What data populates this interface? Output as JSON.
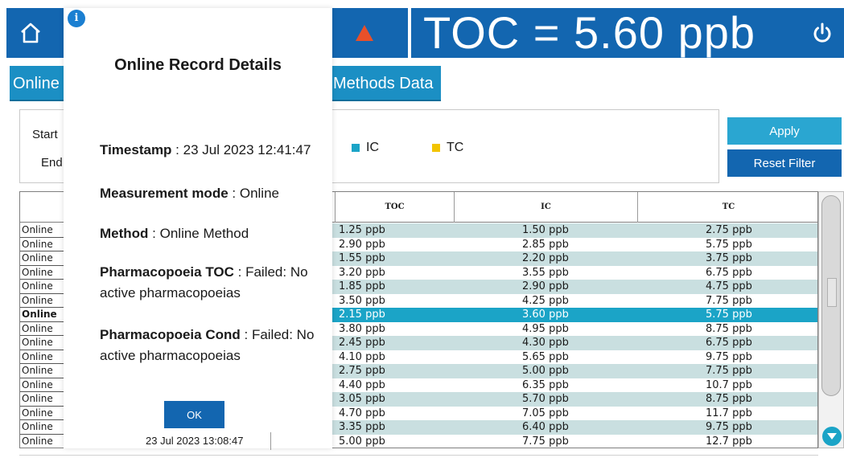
{
  "colors": {
    "topbar": "#1366b0",
    "tab": "#1b8fc4",
    "apply_button": "#2aa6d1",
    "reset_button": "#1366b0",
    "row_shade": "#c9dfe0",
    "row_selected": "#1ba4c7",
    "legend_ic": "#1ba4c7",
    "legend_tc": "#f2c400",
    "alarm": "#e8502a",
    "ok_button": "#1366b0"
  },
  "header": {
    "toc_readout": "TOC = 5.60 ppb",
    "home_icon": "home-icon",
    "alarm_icon": "warning-triangle-icon",
    "power_icon": "power-icon"
  },
  "tabs": [
    {
      "label": "Online"
    },
    {
      "label": "Methods Data"
    }
  ],
  "filter": {
    "start_label": "Start",
    "end_label": "End",
    "legend": [
      {
        "label": "IC"
      },
      {
        "label": "TC"
      }
    ],
    "apply_label": "Apply",
    "reset_label": "Reset Filter"
  },
  "table": {
    "columns": [
      "TOC",
      "IC",
      "TC"
    ],
    "rows": [
      {
        "mode": "Online",
        "toc": "1.25 ppb",
        "ic": "1.50 ppb",
        "tc": "2.75 ppb",
        "shade": true
      },
      {
        "mode": "Online",
        "toc": "2.90 ppb",
        "ic": "2.85 ppb",
        "tc": "5.75 ppb",
        "shade": false
      },
      {
        "mode": "Online",
        "toc": "1.55 ppb",
        "ic": "2.20 ppb",
        "tc": "3.75 ppb",
        "shade": true
      },
      {
        "mode": "Online",
        "toc": "3.20 ppb",
        "ic": "3.55 ppb",
        "tc": "6.75 ppb",
        "shade": false
      },
      {
        "mode": "Online",
        "toc": "1.85 ppb",
        "ic": "2.90 ppb",
        "tc": "4.75 ppb",
        "shade": true
      },
      {
        "mode": "Online",
        "toc": "3.50 ppb",
        "ic": "4.25 ppb",
        "tc": "7.75 ppb",
        "shade": false
      },
      {
        "mode": "Online",
        "toc": "2.15 ppb",
        "ic": "3.60 ppb",
        "tc": "5.75 ppb",
        "selected": true
      },
      {
        "mode": "Online",
        "toc": "3.80 ppb",
        "ic": "4.95 ppb",
        "tc": "8.75 ppb",
        "shade": false
      },
      {
        "mode": "Online",
        "toc": "2.45 ppb",
        "ic": "4.30 ppb",
        "tc": "6.75 ppb",
        "shade": true
      },
      {
        "mode": "Online",
        "toc": "4.10 ppb",
        "ic": "5.65 ppb",
        "tc": "9.75 ppb",
        "shade": false
      },
      {
        "mode": "Online",
        "toc": "2.75 ppb",
        "ic": "5.00 ppb",
        "tc": "7.75 ppb",
        "shade": true
      },
      {
        "mode": "Online",
        "toc": "4.40 ppb",
        "ic": "6.35 ppb",
        "tc": "10.7 ppb",
        "shade": false
      },
      {
        "mode": "Online",
        "toc": "3.05 ppb",
        "ic": "5.70 ppb",
        "tc": "8.75 ppb",
        "shade": true
      },
      {
        "mode": "Online",
        "toc": "4.70 ppb",
        "ic": "7.05 ppb",
        "tc": "11.7 ppb",
        "shade": false
      },
      {
        "mode": "Online",
        "toc": "3.35 ppb",
        "ic": "6.40 ppb",
        "tc": "9.75 ppb",
        "shade": true
      },
      {
        "mode": "Online",
        "toc": "5.00 ppb",
        "ic": "7.75 ppb",
        "tc": "12.7 ppb",
        "shade": false
      }
    ]
  },
  "modal": {
    "info_glyph": "i",
    "title": "Online Record Details",
    "details": [
      {
        "key": "Timestamp",
        "value": "23 Jul 2023 12:41:47"
      },
      {
        "key": "Measurement mode",
        "value": "Online"
      },
      {
        "key": "Method",
        "value": "Online Method"
      },
      {
        "key": "Pharmacopoeia TOC",
        "value": "Failed: No active pharmacopoeias"
      },
      {
        "key": "Pharmacopoeia Cond",
        "value": "Failed: No active pharmacopoeias"
      }
    ],
    "separator": " : ",
    "ok_label": "OK",
    "footer_timestamp": "23 Jul 2023 13:08:47"
  }
}
